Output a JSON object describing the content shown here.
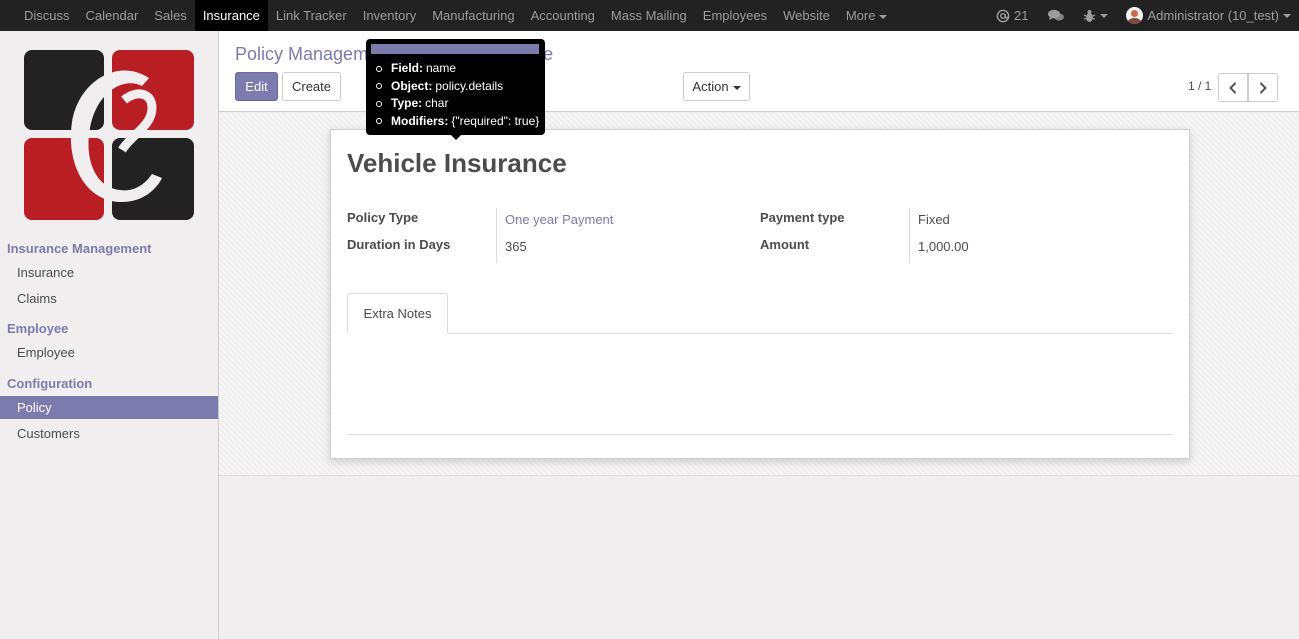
{
  "topmenu": [
    {
      "label": "Discuss",
      "active": false
    },
    {
      "label": "Calendar",
      "active": false
    },
    {
      "label": "Sales",
      "active": false
    },
    {
      "label": "Insurance",
      "active": true
    },
    {
      "label": "Link Tracker",
      "active": false
    },
    {
      "label": "Inventory",
      "active": false
    },
    {
      "label": "Manufacturing",
      "active": false
    },
    {
      "label": "Accounting",
      "active": false
    },
    {
      "label": "Mass Mailing",
      "active": false
    },
    {
      "label": "Employees",
      "active": false
    },
    {
      "label": "Website",
      "active": false
    }
  ],
  "topmenu_more": "More",
  "topright": {
    "mentions_count": "21",
    "user_name": "Administrator (10_test)"
  },
  "sidebar": {
    "sections": [
      {
        "title": "Insurance Management",
        "items": [
          {
            "label": "Insurance",
            "active": false
          },
          {
            "label": "Claims",
            "active": false
          }
        ]
      },
      {
        "title": "Employee",
        "items": [
          {
            "label": "Employee",
            "active": false
          }
        ]
      },
      {
        "title": "Configuration",
        "items": [
          {
            "label": "Policy",
            "active": true
          },
          {
            "label": "Customers",
            "active": false
          }
        ]
      }
    ]
  },
  "control_panel": {
    "breadcrumb_parent": "Policy Managem",
    "breadcrumb_current": "e",
    "edit_label": "Edit",
    "create_label": "Create",
    "action_label": "Action",
    "pager_value": "1 / 1"
  },
  "record": {
    "name": "Vehicle Insurance",
    "fields_left": [
      {
        "label": "Policy Type",
        "value": "One year Payment",
        "is_link": true
      },
      {
        "label": "Duration in Days",
        "value": "365",
        "is_link": false
      }
    ],
    "fields_right": [
      {
        "label": "Payment type",
        "value": "Fixed"
      },
      {
        "label": "Amount",
        "value": "1,000.00"
      }
    ],
    "tab_label": "Extra Notes"
  },
  "tooltip": {
    "rows": [
      {
        "key": "Field:",
        "value": "name"
      },
      {
        "key": "Object:",
        "value": "policy.details"
      },
      {
        "key": "Type:",
        "value": "char"
      },
      {
        "key": "Modifiers:",
        "value": "{\"required\": true}"
      }
    ]
  },
  "colors": {
    "brand": "#7c7bad",
    "navbar": "#222222",
    "logo_red": "#b81e24",
    "logo_dark": "#222222"
  }
}
